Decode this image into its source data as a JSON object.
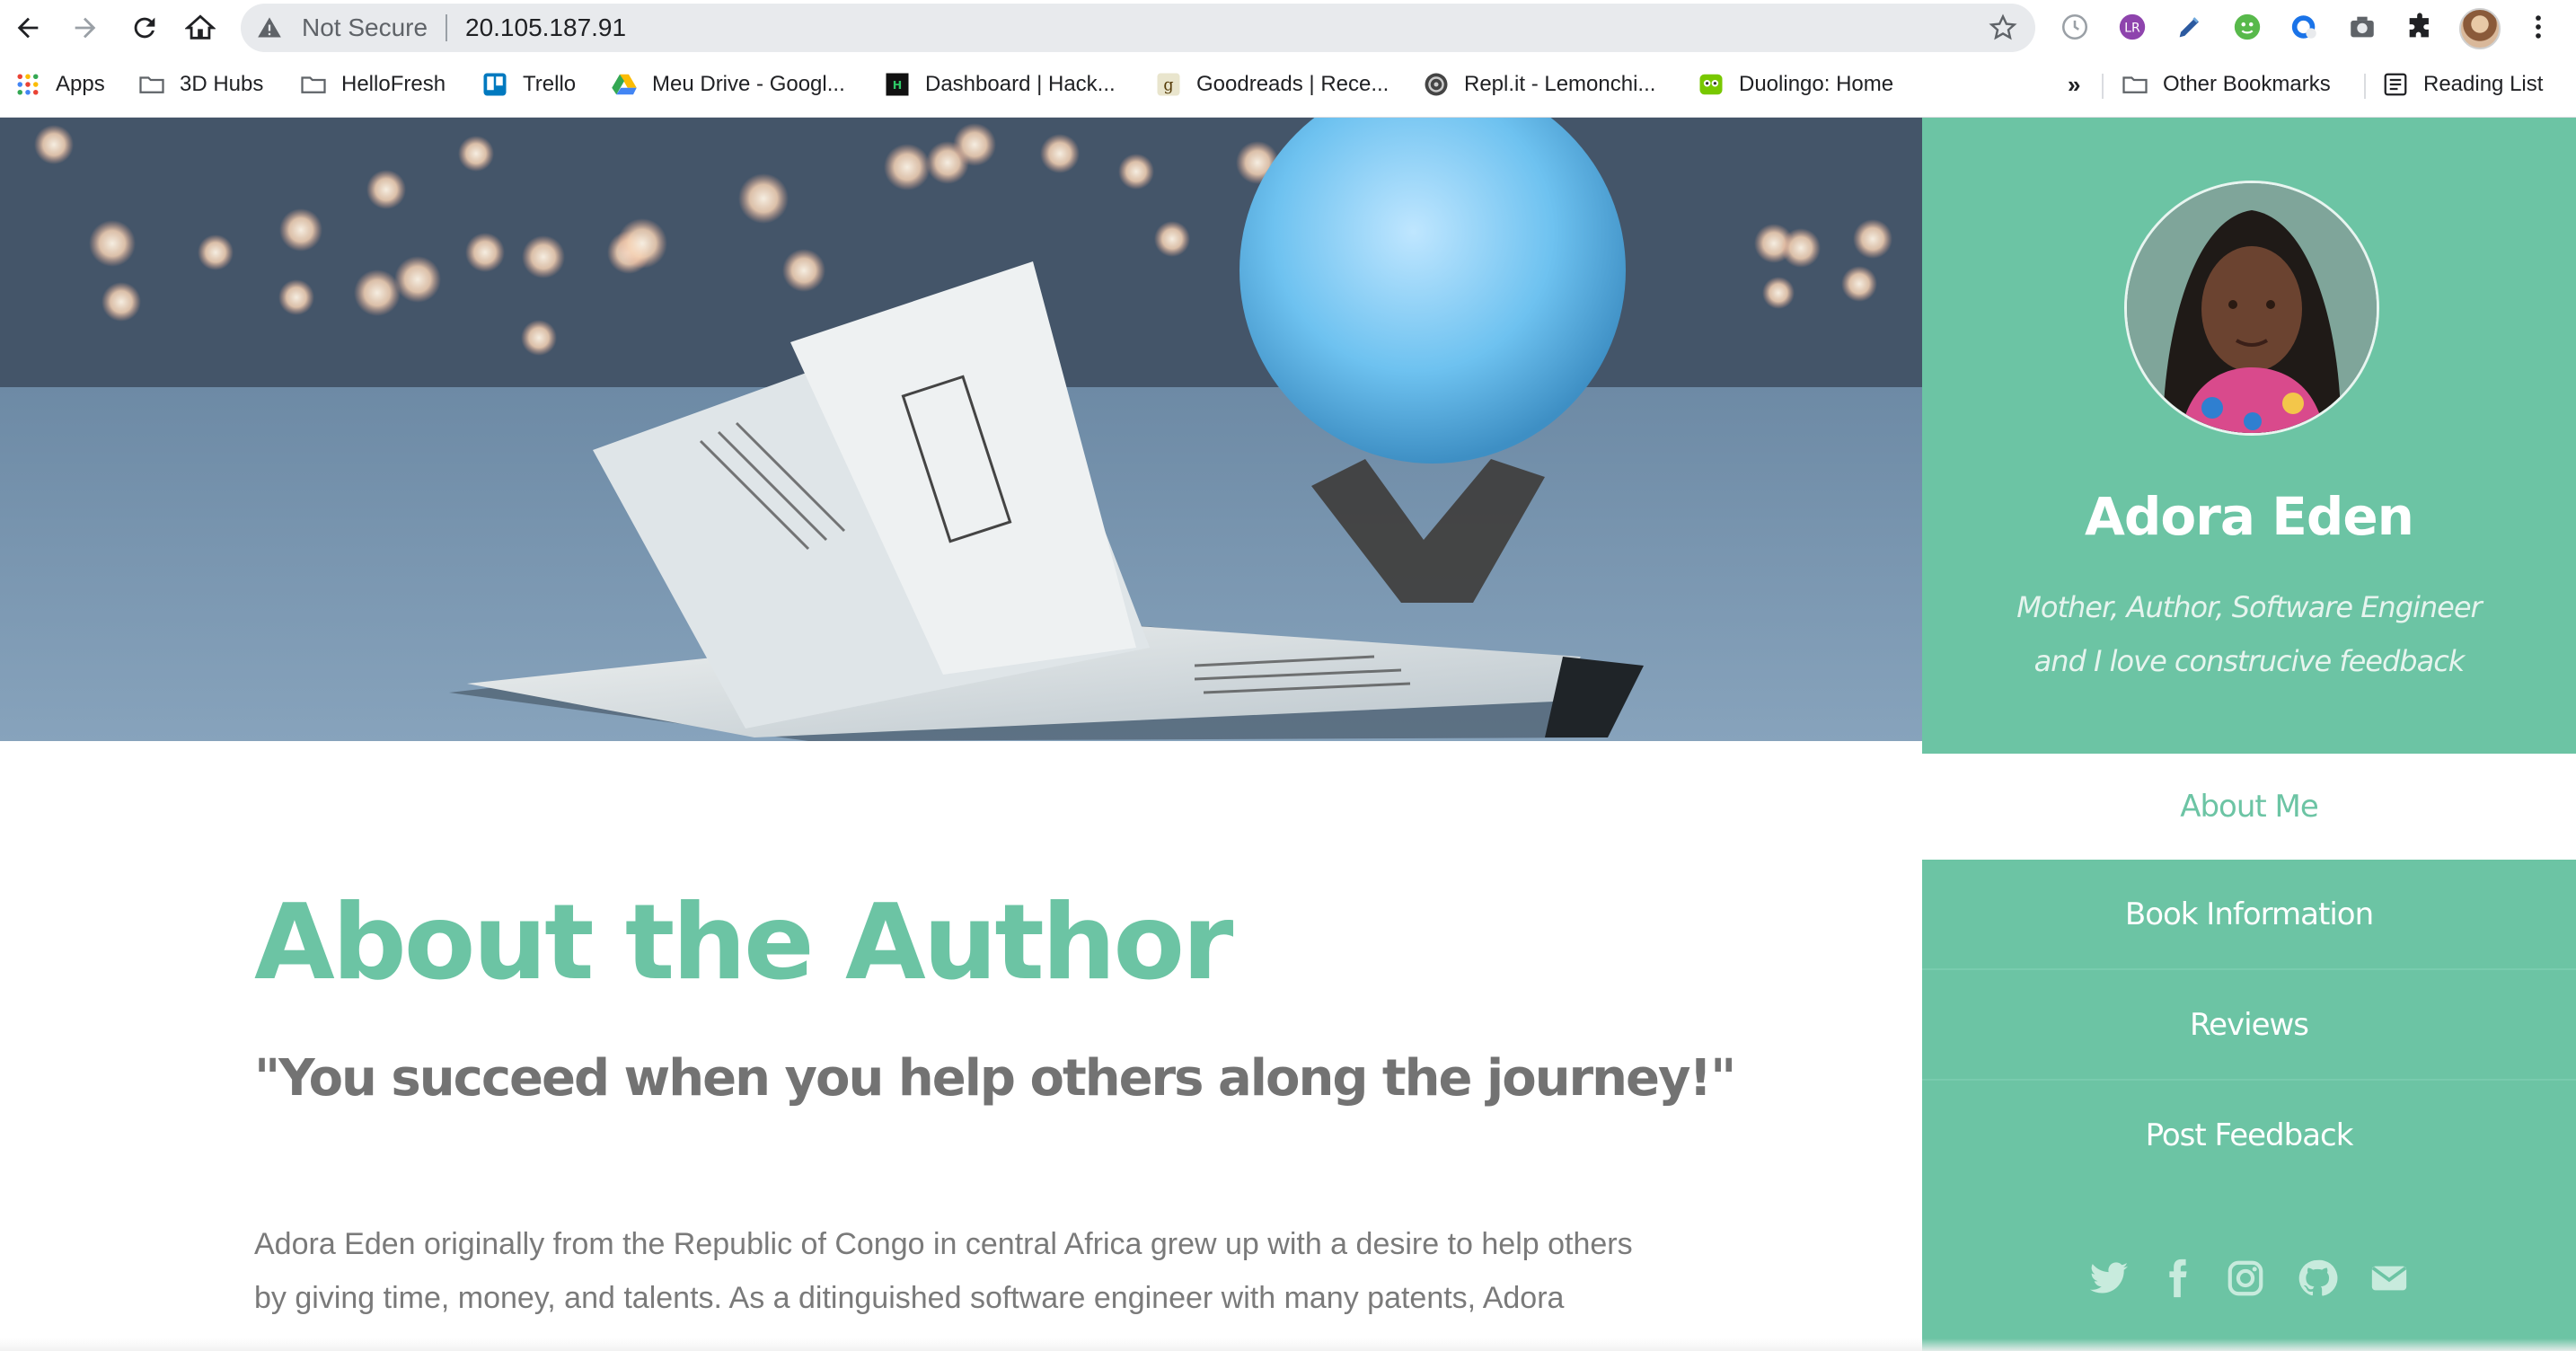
{
  "browser": {
    "security_label": "Not Secure",
    "url": "20.105.187.91",
    "bookmarks": [
      {
        "label": "Apps",
        "icon": "apps-grid-icon"
      },
      {
        "label": "3D Hubs",
        "icon": "folder-icon"
      },
      {
        "label": "HelloFresh",
        "icon": "folder-icon"
      },
      {
        "label": "Trello",
        "icon": "trello-icon"
      },
      {
        "label": "Meu Drive - Googl...",
        "icon": "google-drive-icon"
      },
      {
        "label": "Dashboard | Hack...",
        "icon": "hackerrank-icon"
      },
      {
        "label": "Goodreads | Rece...",
        "icon": "goodreads-icon"
      },
      {
        "label": "Repl.it - Lemonchi...",
        "icon": "replit-icon"
      },
      {
        "label": "Duolingo: Home",
        "icon": "duolingo-icon"
      }
    ],
    "overflow_label": "»",
    "other_bookmarks": "Other Bookmarks",
    "reading_list": "Reading List"
  },
  "sidebar": {
    "name": "Adora Eden",
    "tagline_line1": "Mother, Author, Software Engineer",
    "tagline_line2": "and I love construcive feedback",
    "nav": {
      "active": "About Me",
      "items": [
        "Book Information",
        "Reviews",
        "Post Feedback"
      ]
    },
    "social": [
      "twitter-icon",
      "facebook-icon",
      "instagram-icon",
      "github-icon",
      "email-icon"
    ]
  },
  "main": {
    "title": "About the Author",
    "quote": "\"You succeed when you help others along the journey!\"",
    "body": "Adora Eden originally from the Republic of Congo in central Africa grew up with a desire to help others by giving time, money, and talents. As a ditinguished software engineer with many patents, Adora"
  },
  "colors": {
    "accent": "#6cc4a4",
    "text_gray": "#737373",
    "white": "#ffffff"
  }
}
